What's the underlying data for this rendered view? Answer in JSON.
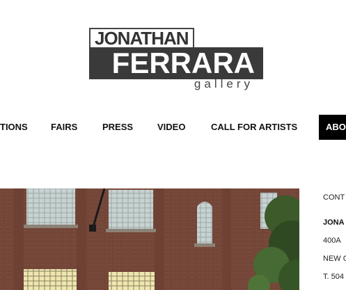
{
  "logo": {
    "line1": "JONATHAN",
    "line2": "FERRARA",
    "line3": "gallery"
  },
  "nav": {
    "items": [
      {
        "label": "TIONS"
      },
      {
        "label": "FAIRS"
      },
      {
        "label": "PRESS"
      },
      {
        "label": "VIDEO"
      },
      {
        "label": "CALL FOR ARTISTS"
      },
      {
        "label": "ABO"
      }
    ]
  },
  "contact": {
    "heading": "CONT",
    "name": "JONA",
    "address1": "400A",
    "address2": "NEW O",
    "phone": "T. 504"
  },
  "colors": {
    "logo_dark": "#3a3a3a",
    "nav_active_bg": "#000000",
    "brick": "#7a4a3a"
  }
}
